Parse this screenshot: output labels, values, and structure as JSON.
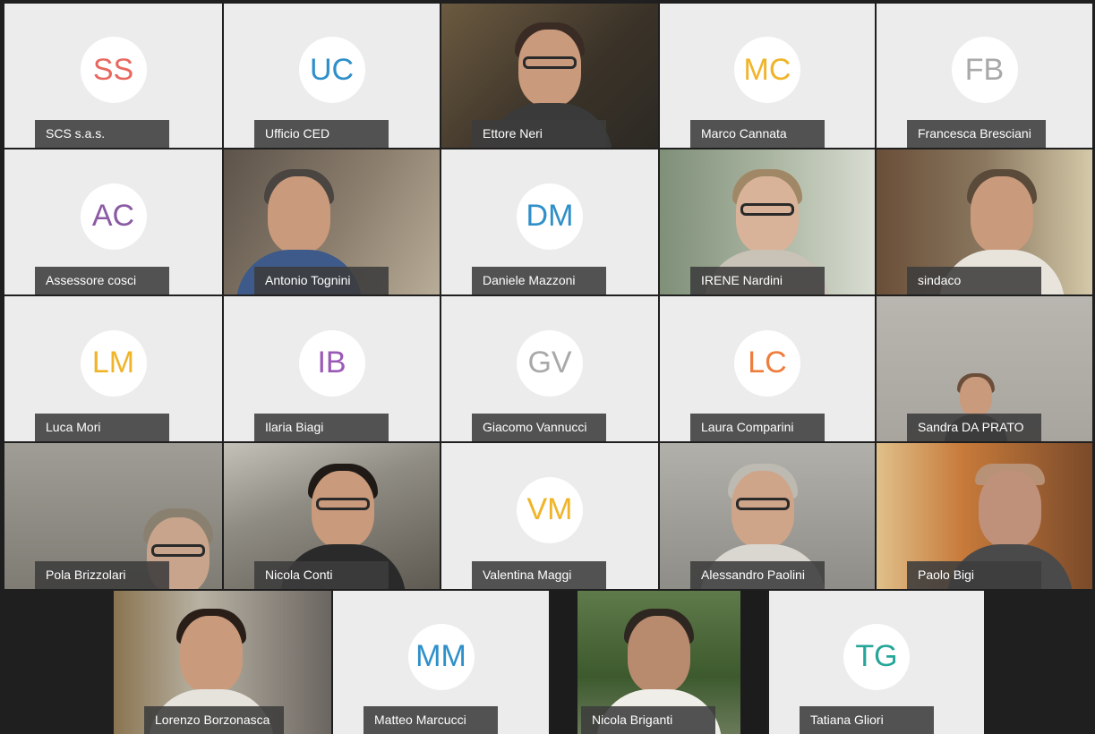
{
  "participants": [
    {
      "initials": "SS",
      "name": "SCS s.a.s.",
      "color": "#e8685e",
      "video": false
    },
    {
      "initials": "UC",
      "name": "Ufficio CED",
      "color": "#2e8fc9",
      "video": false
    },
    {
      "initials": "",
      "name": "Ettore Neri",
      "color": "#5a4a3e",
      "video": true
    },
    {
      "initials": "MC",
      "name": "Marco Cannata",
      "color": "#f0b429",
      "video": false
    },
    {
      "initials": "FB",
      "name": "Francesca Bresciani",
      "color": "#a9a9a9",
      "video": false
    },
    {
      "initials": "AC",
      "name": "Assessore cosci",
      "color": "#8b5aa3",
      "video": false
    },
    {
      "initials": "",
      "name": "Antonio Tognini",
      "color": "#6e6256",
      "video": true
    },
    {
      "initials": "DM",
      "name": "Daniele Mazzoni",
      "color": "#2e8fc9",
      "video": false
    },
    {
      "initials": "",
      "name": "IRENE Nardini",
      "color": "#7e8c7a",
      "video": true
    },
    {
      "initials": "",
      "name": "sindaco",
      "color": "#7b6a58",
      "video": true
    },
    {
      "initials": "LM",
      "name": "Luca Mori",
      "color": "#f0b429",
      "video": false
    },
    {
      "initials": "IB",
      "name": "Ilaria Biagi",
      "color": "#9b59b6",
      "video": false
    },
    {
      "initials": "GV",
      "name": "Giacomo Vannucci",
      "color": "#a9a9a9",
      "video": false
    },
    {
      "initials": "LC",
      "name": "Laura Comparini",
      "color": "#ef7d3c",
      "video": false
    },
    {
      "initials": "",
      "name": "Sandra DA PRATO",
      "color": "#9a9590",
      "video": true
    },
    {
      "initials": "",
      "name": "Pola Brizzolari",
      "color": "#8f8f87",
      "video": true
    },
    {
      "initials": "",
      "name": "Nicola Conti",
      "color": "#77746c",
      "video": true
    },
    {
      "initials": "VM",
      "name": "Valentina Maggi",
      "color": "#f0b429",
      "video": false
    },
    {
      "initials": "",
      "name": "Alessandro Paolini",
      "color": "#9a9a95",
      "video": true
    },
    {
      "initials": "",
      "name": "Paolo Bigi",
      "color": "#8a6a4a",
      "video": true
    },
    {
      "initials": "",
      "name": "Lorenzo Borzonasca",
      "color": "#7c7468",
      "video": true
    },
    {
      "initials": "MM",
      "name": "Matteo Marcucci",
      "color": "#2e8fc9",
      "video": false
    },
    {
      "initials": "",
      "name": "Nicola Briganti",
      "color": "#4e6a3e",
      "video": true
    },
    {
      "initials": "TG",
      "name": "Tatiana Gliori",
      "color": "#26a69a",
      "video": false
    }
  ]
}
